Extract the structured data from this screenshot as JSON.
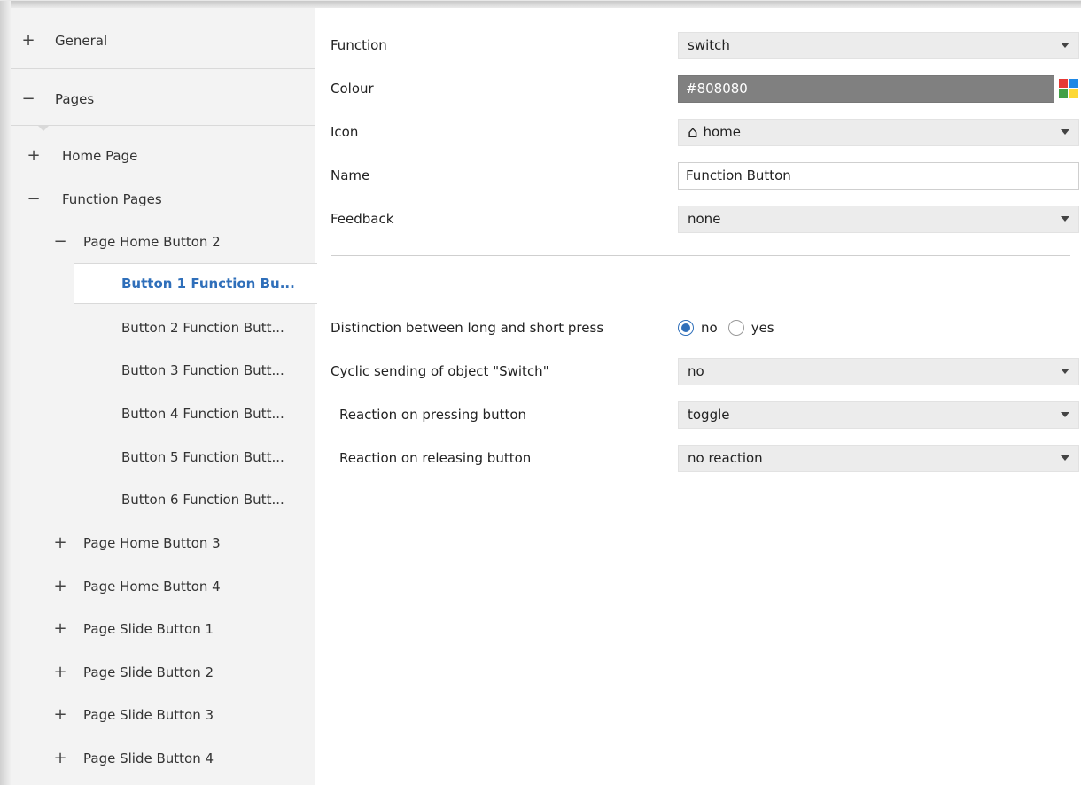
{
  "sidebar": {
    "items": [
      {
        "label": "General",
        "toggle": "+"
      },
      {
        "label": "Pages",
        "toggle": "−"
      },
      {
        "label": "Home Page",
        "toggle": "+"
      },
      {
        "label": "Function Pages",
        "toggle": "−"
      },
      {
        "label": "Page Home Button 2",
        "toggle": "−"
      },
      {
        "label": "Button 1 Function Bu..."
      },
      {
        "label": "Button 2 Function Butt..."
      },
      {
        "label": "Button 3 Function Butt..."
      },
      {
        "label": "Button 4 Function Butt..."
      },
      {
        "label": "Button 5 Function Butt..."
      },
      {
        "label": "Button 6 Function Butt..."
      },
      {
        "label": "Page Home Button 3",
        "toggle": "+"
      },
      {
        "label": "Page Home Button 4",
        "toggle": "+"
      },
      {
        "label": "Page Slide Button 1",
        "toggle": "+"
      },
      {
        "label": "Page Slide Button 2",
        "toggle": "+"
      },
      {
        "label": "Page Slide Button 3",
        "toggle": "+"
      },
      {
        "label": "Page Slide Button 4",
        "toggle": "+"
      }
    ]
  },
  "form": {
    "function": {
      "label": "Function",
      "value": "switch"
    },
    "colour": {
      "label": "Colour",
      "value": "#808080"
    },
    "icon": {
      "label": "Icon",
      "value": "home",
      "glyph": "⌂"
    },
    "name": {
      "label": "Name",
      "value": "Function Button"
    },
    "feedback": {
      "label": "Feedback",
      "value": "none"
    },
    "distinction": {
      "label": "Distinction between long and short press",
      "options": [
        "no",
        "yes"
      ],
      "selected": "no"
    },
    "cyclic": {
      "label": "Cyclic sending of object \"Switch\"",
      "value": "no"
    },
    "pressing": {
      "label": "Reaction on pressing button",
      "value": "toggle"
    },
    "releasing": {
      "label": "Reaction on releasing button",
      "value": "no reaction"
    }
  },
  "colors": {
    "accent": "#2f6fba",
    "colour_swatch": "#808080",
    "palette": [
      "#e53935",
      "#1e88e5",
      "#43a047",
      "#fdd835"
    ]
  }
}
